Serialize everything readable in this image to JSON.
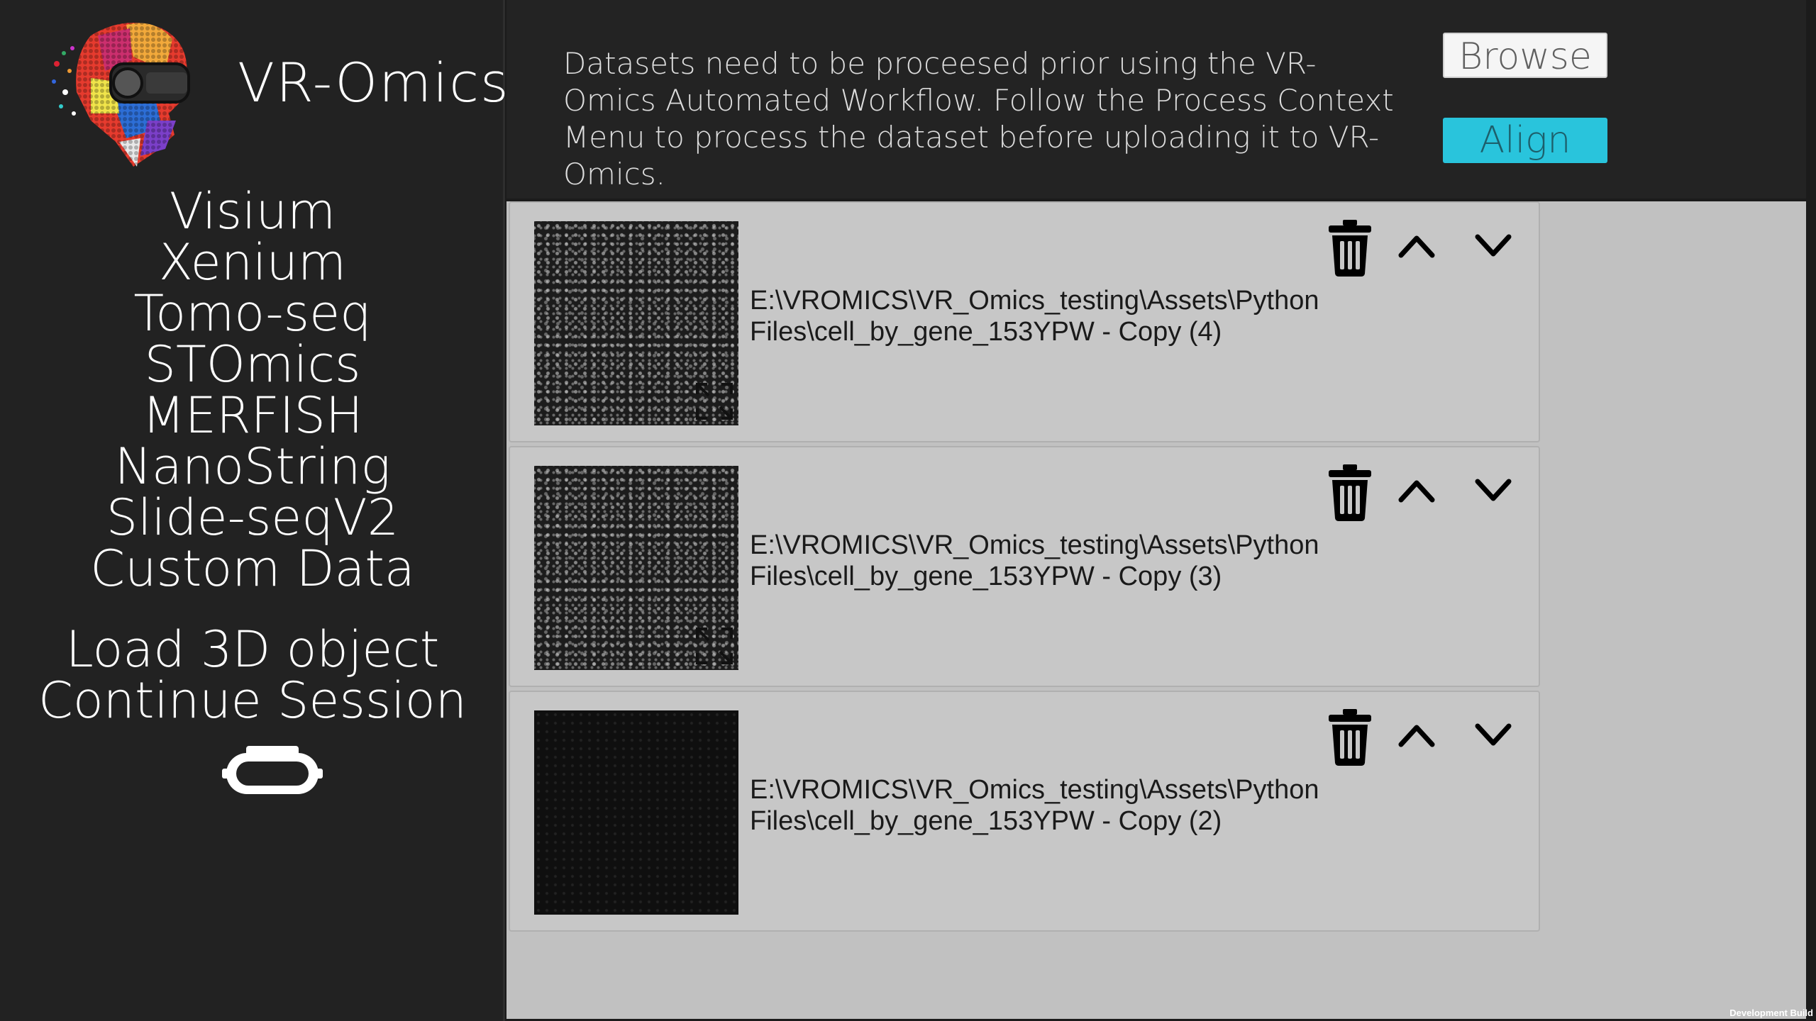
{
  "app": {
    "title": "VR-Omics"
  },
  "sidebar": {
    "menu": [
      {
        "label": "Visium"
      },
      {
        "label": "Xenium"
      },
      {
        "label": "Tomo-seq"
      },
      {
        "label": "STOmics"
      },
      {
        "label": "MERFISH"
      },
      {
        "label": "NanoString"
      },
      {
        "label": "Slide-seqV2"
      },
      {
        "label": "Custom Data"
      }
    ],
    "secondary": [
      {
        "label": "Load 3D object"
      },
      {
        "label": "Continue Session"
      }
    ],
    "vr_icon": "vr-headset-icon"
  },
  "header": {
    "info": "Datasets need to be proceesed prior using the VR-Omics Automated Workflow. Follow the Process Context Menu to process the dataset before uploading it to VR-Omics.",
    "browse_label": "Browse",
    "align_label": "Align"
  },
  "datasets": [
    {
      "path": "E:\\VROMICS\\VR_Omics_testing\\Assets\\PythonFiles\\cell_by_gene_153YPW - Copy (4)",
      "thumbnail": "bright"
    },
    {
      "path": "E:\\VROMICS\\VR_Omics_testing\\Assets\\PythonFiles\\cell_by_gene_153YPW - Copy (3)",
      "thumbnail": "bright"
    },
    {
      "path": "E:\\VROMICS\\VR_Omics_testing\\Assets\\PythonFiles\\cell_by_gene_153YPW - Copy (2)",
      "thumbnail": "dark"
    }
  ],
  "footer": {
    "build_label": "Development Build"
  },
  "colors": {
    "accent": "#29c4dc",
    "sidebar": "#222222",
    "content": "#c1c1c1"
  },
  "icons": [
    "trash-icon",
    "chevron-up-icon",
    "chevron-down-icon",
    "expand-icon",
    "vr-headset-icon",
    "brain-logo"
  ]
}
